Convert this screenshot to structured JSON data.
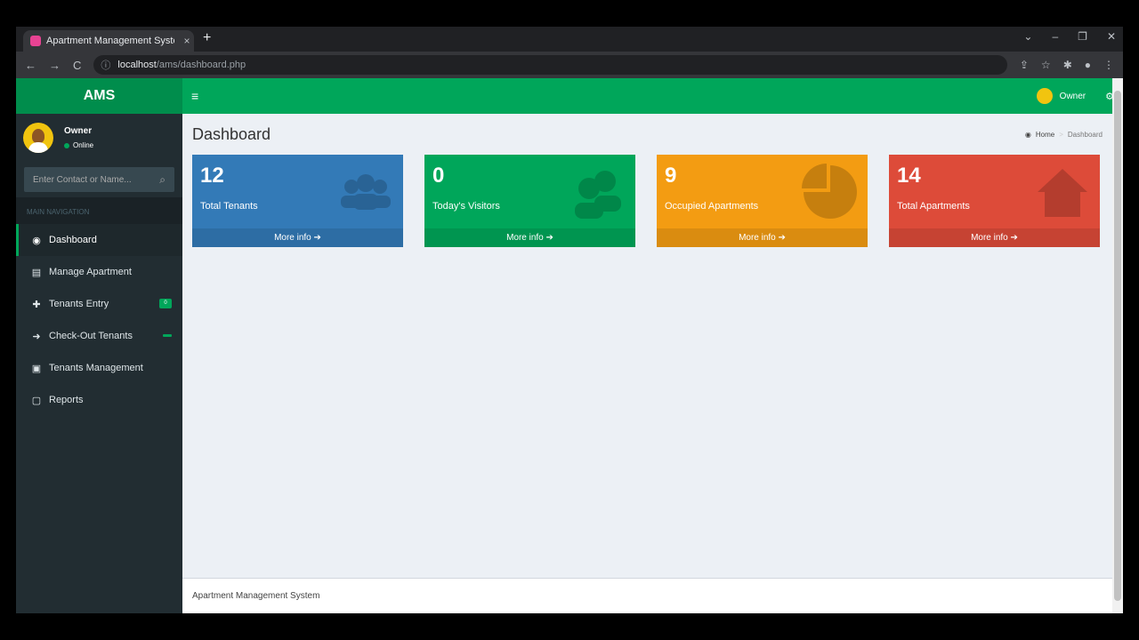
{
  "browser": {
    "tab_title": "Apartment Management System",
    "tab_close": "×",
    "new_tab": "+",
    "url_host": "localhost",
    "url_path": "/ams/dashboard.php",
    "window_controls": [
      "⌄",
      "–",
      "❐",
      "✕"
    ]
  },
  "brand": {
    "logo": "AMS",
    "color": "#00a65a"
  },
  "user": {
    "name": "Owner",
    "status": "Online"
  },
  "search": {
    "placeholder": "Enter Contact or Name..."
  },
  "nav": {
    "header": "MAIN NAVIGATION",
    "items": [
      {
        "label": "Dashboard",
        "icon": "dashboard-icon",
        "active": true
      },
      {
        "label": "Manage Apartment",
        "icon": "building-icon"
      },
      {
        "label": "Tenants Entry",
        "icon": "plus-icon",
        "badge": "0"
      },
      {
        "label": "Check-Out Tenants",
        "icon": "sign-out-icon"
      },
      {
        "label": "Tenants Management",
        "icon": "id-card-icon"
      },
      {
        "label": "Reports",
        "icon": "file-icon"
      }
    ]
  },
  "topbar": {
    "menu_icon": "≡",
    "user_name": "Owner"
  },
  "page": {
    "title": "Dashboard",
    "breadcrumb": {
      "home": "Home",
      "current": "Dashboard"
    }
  },
  "stats": [
    {
      "value": "12",
      "label": "Total Tenants",
      "more": "More info",
      "color": "#337ab7",
      "icon": "users-icon"
    },
    {
      "value": "0",
      "label": "Today's Visitors",
      "more": "More info",
      "color": "#00a65a",
      "icon": "visitors-icon"
    },
    {
      "value": "9",
      "label": "Occupied Apartments",
      "more": "More info",
      "color": "#f39c12",
      "icon": "pie-chart-icon"
    },
    {
      "value": "14",
      "label": "Total Apartments",
      "more": "More info",
      "color": "#dd4b39",
      "icon": "home-icon"
    }
  ],
  "footer": {
    "text": "Apartment Management System"
  }
}
